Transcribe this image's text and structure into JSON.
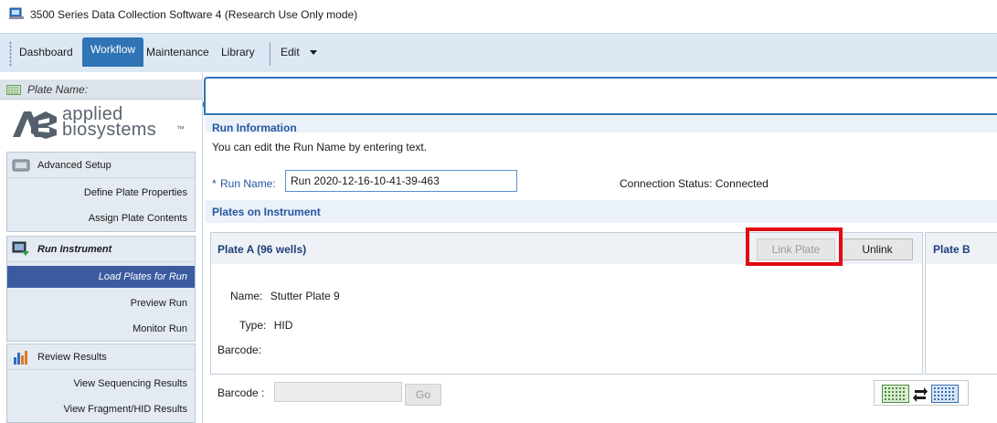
{
  "window": {
    "title": "3500 Series Data Collection Software 4 (Research Use Only mode)"
  },
  "menubar": {
    "tabs": [
      {
        "label": "Dashboard"
      },
      {
        "label": "Workflow"
      },
      {
        "label": "Maintenance"
      },
      {
        "label": "Library"
      }
    ],
    "active_tab": "Workflow",
    "edit_label": "Edit",
    "edit_icon": "chevron-down-icon"
  },
  "sidebar": {
    "plate_name_label": "Plate Name:",
    "logo": {
      "line1": "applied",
      "line2": "biosystems",
      "tm": "™"
    },
    "sections": [
      {
        "label": "Advanced Setup",
        "icon": "advanced-setup-icon",
        "items": [
          {
            "label": "Define Plate Properties"
          },
          {
            "label": "Assign Plate Contents"
          }
        ]
      },
      {
        "label": "Run Instrument",
        "icon": "run-instrument-icon",
        "items": [
          {
            "label": "Load Plates for Run",
            "active": true
          },
          {
            "label": "Preview Run"
          },
          {
            "label": "Monitor Run"
          }
        ]
      },
      {
        "label": "Review Results",
        "icon": "bar-chart-icon",
        "items": [
          {
            "label": "View Sequencing Results"
          },
          {
            "label": "View Fragment/HID Results"
          }
        ]
      }
    ]
  },
  "run_info": {
    "title": "Run Information",
    "description": "You can edit the Run Name by entering text.",
    "run_name_required_marker": "*",
    "run_name_label": "Run Name:",
    "run_name_value": "Run 2020-12-16-10-41-39-463",
    "connection_status_label": "Connection Status:",
    "connection_status_value": "Connected"
  },
  "plates": {
    "title": "Plates on Instrument",
    "plate_a": {
      "title": "Plate A (96 wells)",
      "link_button": "Link Plate",
      "unlink_button": "Unlink",
      "name_label": "Name:",
      "name_value": "Stutter Plate 9",
      "type_label": "Type:",
      "type_value": "HID",
      "barcode_label": "Barcode:"
    },
    "plate_b": {
      "title": "Plate B"
    }
  },
  "barcode_entry": {
    "label": "Barcode :",
    "input_value": "",
    "go_button": "Go"
  },
  "colors": {
    "accent_blue": "#2f74b5",
    "nav_active": "#3b5ba0",
    "highlight_red": "#e30613",
    "section_title": "#2656a0"
  }
}
